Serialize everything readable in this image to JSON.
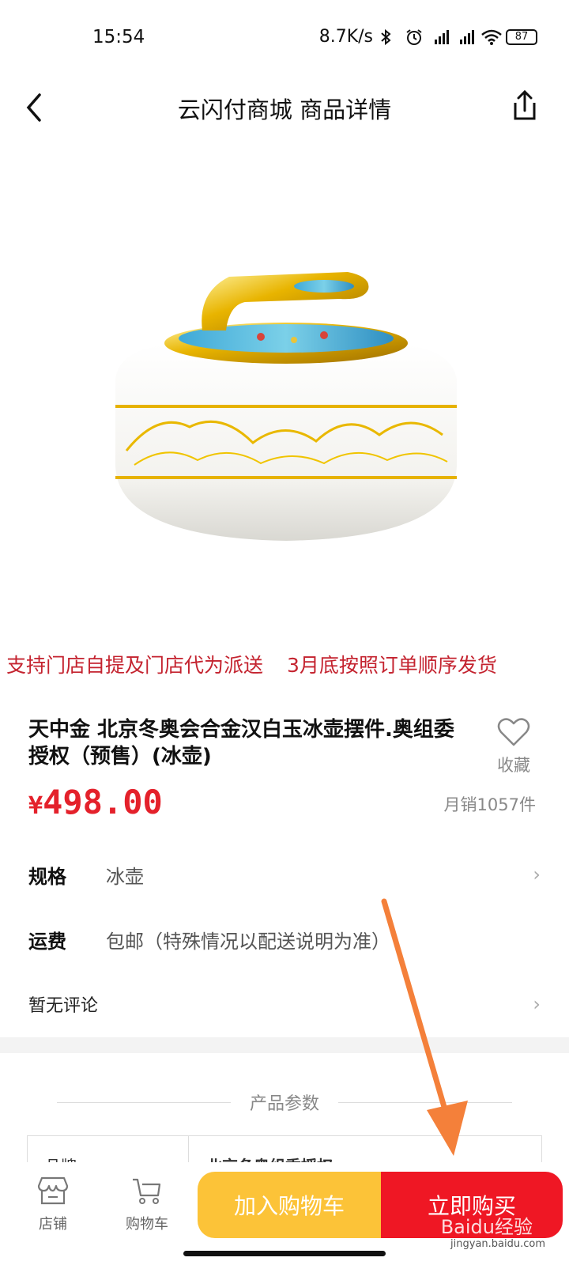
{
  "status_bar": {
    "time": "15:54",
    "network_speed": "8.7K/s",
    "battery": "87",
    "icons": [
      "bluetooth-icon",
      "alarm-icon",
      "hd-signal-icon",
      "hd-signal-icon",
      "wifi-icon",
      "battery-icon"
    ]
  },
  "nav": {
    "title": "云闪付商城 商品详情",
    "back_icon": "chevron-left-icon",
    "share_icon": "share-icon"
  },
  "notice": {
    "left": "支持门店自提及门店代为派送",
    "right": "3月底按照订单顺序发货"
  },
  "product": {
    "title": "天中金 北京冬奥会合金汉白玉冰壶摆件.奥组委授权（预售）(冰壶)",
    "favorite_label": "收藏",
    "price_symbol": "¥",
    "price": "498.00",
    "monthly_sales": "月销1057件"
  },
  "rows": {
    "spec_label": "规格",
    "spec_value": "冰壶",
    "shipping_label": "运费",
    "shipping_value": "包邮（特殊情况以配送说明为准）",
    "reviews_label": "暂无评论"
  },
  "params": {
    "title": "产品参数",
    "key": "品牌",
    "value": "北京冬奥组委授权"
  },
  "bottom_bar": {
    "store_label": "店铺",
    "cart_label": "购物车",
    "add_to_cart": "加入购物车",
    "buy_now": "立即购买"
  },
  "watermark": {
    "brand": "Baidu经验",
    "url": "jingyan.baidu.com"
  },
  "colors": {
    "accent_red": "#ef1724",
    "price_red": "#e4212b",
    "cart_yellow": "#fcc338",
    "annotation_orange": "#f4803a"
  }
}
